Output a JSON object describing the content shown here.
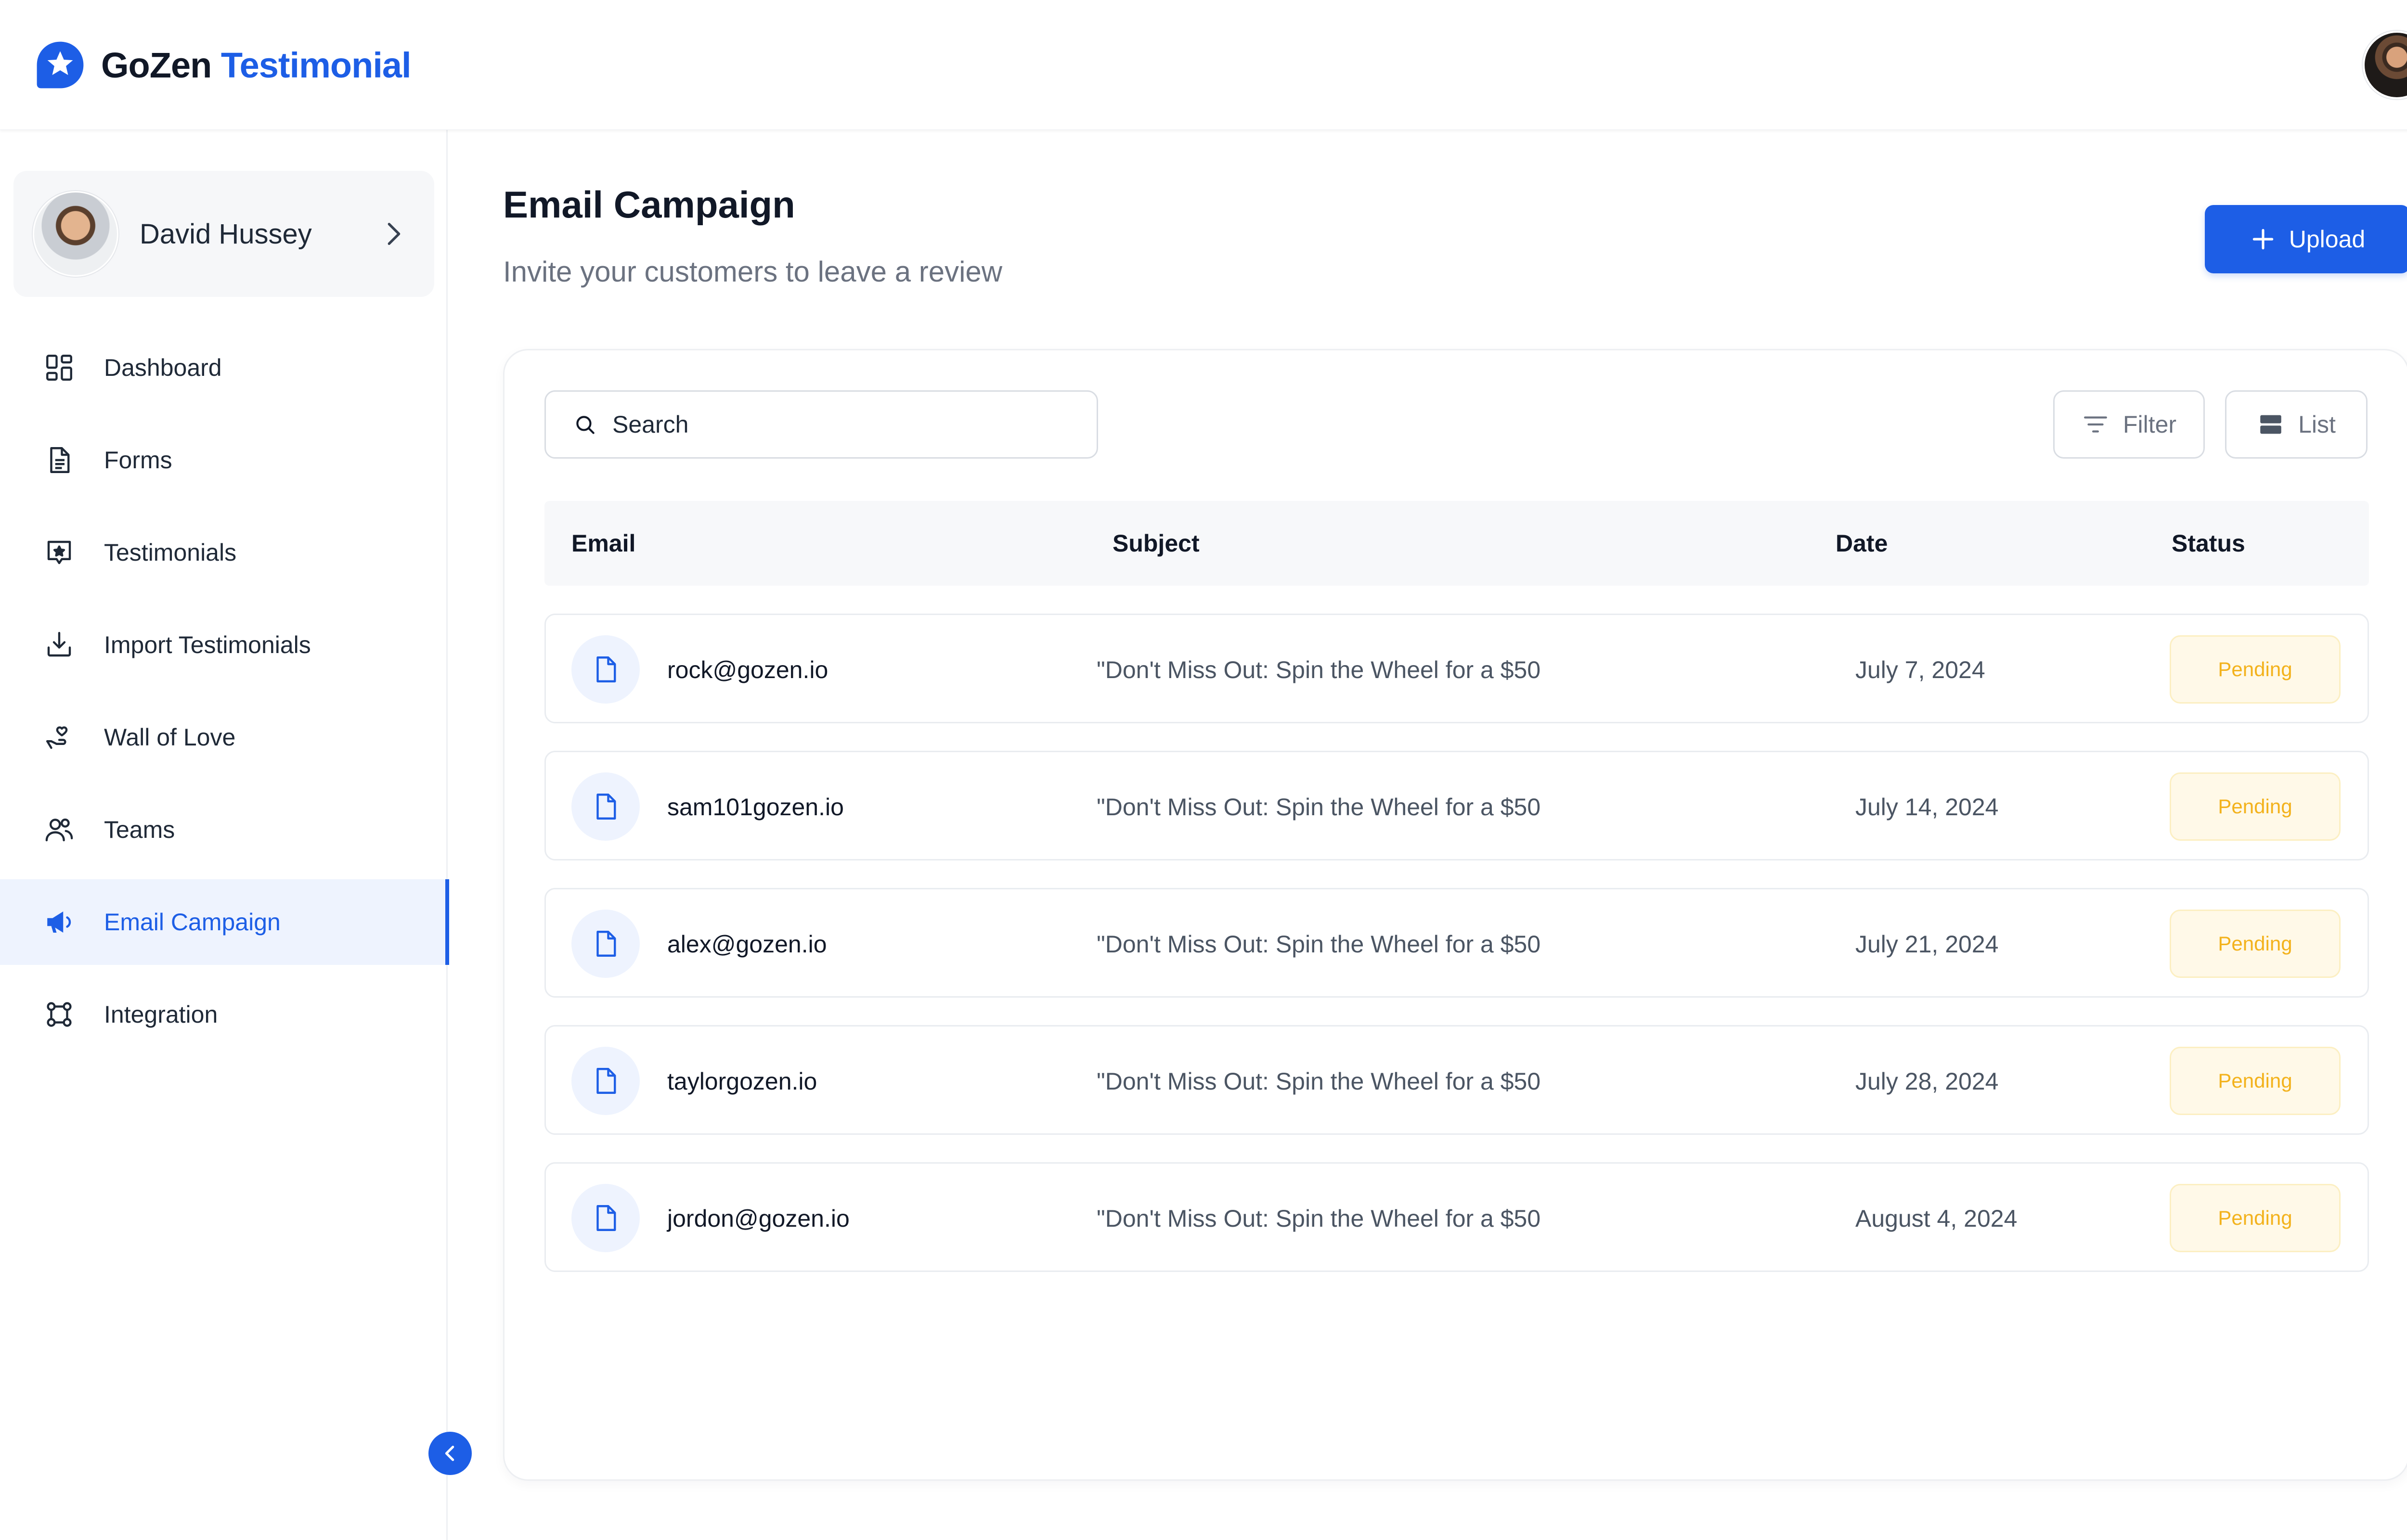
{
  "brand": {
    "name_part1": "GoZen",
    "name_part2": "Testimonial"
  },
  "colors": {
    "accent": "#1d5ee6",
    "pending": "#f3b21c",
    "pending_bg": "#fff9e8"
  },
  "profile": {
    "name": "David Hussey"
  },
  "nav": [
    {
      "label": "Dashboard",
      "icon": "dashboard-icon",
      "active": false
    },
    {
      "label": "Forms",
      "icon": "forms-icon",
      "active": false
    },
    {
      "label": "Testimonials",
      "icon": "testimonials-icon",
      "active": false
    },
    {
      "label": "Import Testimonials",
      "icon": "import-icon",
      "active": false
    },
    {
      "label": "Wall of Love",
      "icon": "wall-of-love-icon",
      "active": false
    },
    {
      "label": "Teams",
      "icon": "teams-icon",
      "active": false
    },
    {
      "label": "Email Campaign",
      "icon": "megaphone-icon",
      "active": true
    },
    {
      "label": "Integration",
      "icon": "integration-icon",
      "active": false
    }
  ],
  "page": {
    "title": "Email Campaign",
    "subtitle": "Invite your customers to leave a review",
    "upload_label": "Upload"
  },
  "toolbar": {
    "search_placeholder": "Search",
    "filter_label": "Filter",
    "list_label": "List"
  },
  "table": {
    "columns": [
      "Email",
      "Subject",
      "Date",
      "Status"
    ],
    "rows": [
      {
        "email": "rock@gozen.io",
        "subject": "\"Don't Miss Out: Spin the Wheel for a $50",
        "date": "July 7, 2024",
        "status": "Pending"
      },
      {
        "email": "sam101gozen.io",
        "subject": "\"Don't Miss Out: Spin the Wheel for a $50",
        "date": "July 14, 2024",
        "status": "Pending"
      },
      {
        "email": "alex@gozen.io",
        "subject": "\"Don't Miss Out: Spin the Wheel for a $50",
        "date": "July 21, 2024",
        "status": "Pending"
      },
      {
        "email": "taylorgozen.io",
        "subject": "\"Don't Miss Out: Spin the Wheel for a $50",
        "date": "July 28, 2024",
        "status": "Pending"
      },
      {
        "email": "jordon@gozen.io",
        "subject": "\"Don't Miss Out: Spin the Wheel for a $50",
        "date": "August 4, 2024",
        "status": "Pending"
      }
    ]
  }
}
